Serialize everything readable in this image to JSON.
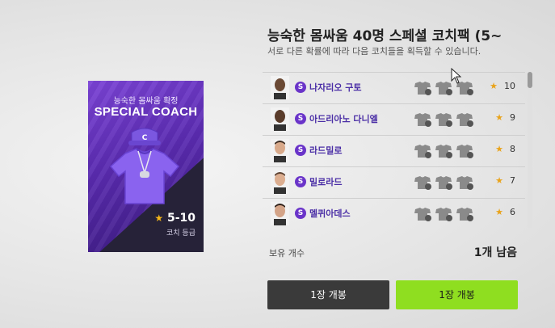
{
  "card": {
    "subtitle": "능숙한 몸싸움 확정",
    "title": "SPECIAL COACH",
    "grade": "5-10",
    "grade_label": "코치 등급",
    "jersey_letter": "C"
  },
  "pack": {
    "title": "능숙한 몸싸움 40명 스페셜 코치팩 (5~",
    "description": "서로 다른 확률에 따라 다음 코치들을 획득할 수 있습니다."
  },
  "coaches": [
    {
      "name": "나자리오 구토",
      "rating": "10",
      "badge": "S"
    },
    {
      "name": "아드리아노 다니엘",
      "rating": "9",
      "badge": "S"
    },
    {
      "name": "라드밀로",
      "rating": "8",
      "badge": "S"
    },
    {
      "name": "밀로라드",
      "rating": "7",
      "badge": "S"
    },
    {
      "name": "멜퀴아데스",
      "rating": "6",
      "badge": "S"
    }
  ],
  "owned": {
    "label": "보유 개수",
    "value": "1개 남음"
  },
  "buttons": {
    "open_one_dark": "1장 개봉",
    "open_one_green": "1장 개봉"
  }
}
